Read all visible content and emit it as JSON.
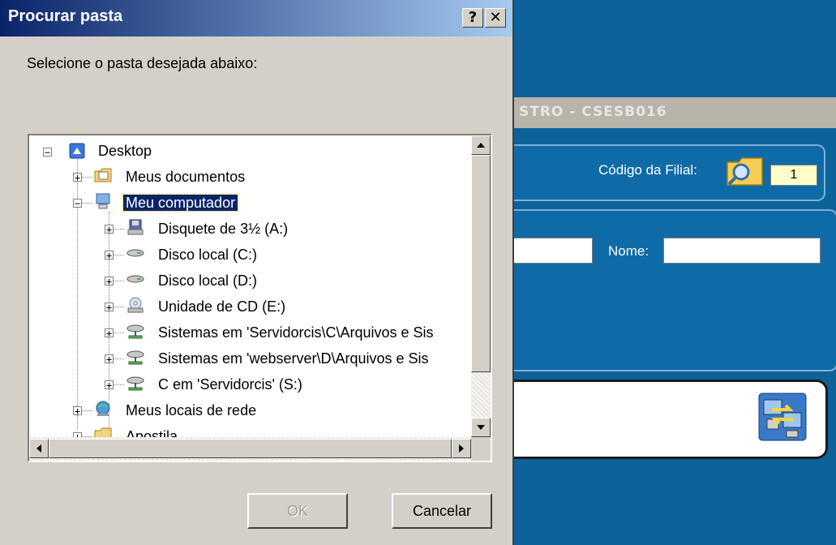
{
  "background": {
    "window_title": "STRO - CSESB016",
    "filial_label": "Código da Filial:",
    "filial_value": "1",
    "nome_label": "Nome:"
  },
  "dialog": {
    "title": "Procurar pasta",
    "help_label": "?",
    "close_label": "✕",
    "prompt": "Selecione o pasta desejada abaixo:",
    "ok_label": "OK",
    "cancel_label": "Cancelar",
    "tree": {
      "root": "Desktop",
      "items": [
        {
          "label": "Meus documentos"
        },
        {
          "label": "Meu computador",
          "selected": true
        },
        {
          "label": "Disquete de 3½ (A:)"
        },
        {
          "label": "Disco local (C:)"
        },
        {
          "label": "Disco local (D:)"
        },
        {
          "label": "Unidade de CD (E:)"
        },
        {
          "label": "Sistemas em 'Servidorcis\\C\\Arquivos e Sis"
        },
        {
          "label": "Sistemas em 'webserver\\D\\Arquivos e Sis"
        },
        {
          "label": "C em 'Servidorcis' (S:)"
        },
        {
          "label": "Meus locais de rede"
        },
        {
          "label": "Apostila"
        }
      ]
    }
  }
}
